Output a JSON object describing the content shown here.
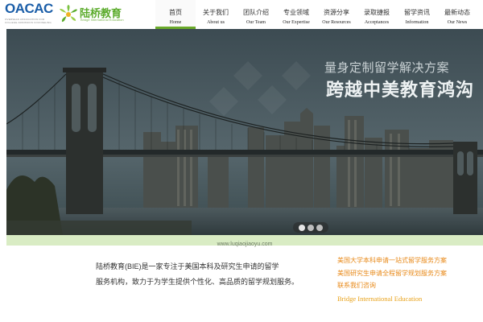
{
  "brand": {
    "oacac_logo": "OACAC",
    "oacac_subtitle": "OVERSEAS ASSOCIATION FOR COLLEGE ADMISSION COUNSELING",
    "luqiao_name": "陆桥教育",
    "luqiao_subtitle": "Bridge International Education"
  },
  "nav": [
    {
      "cn": "首页",
      "en": "Home",
      "active": true
    },
    {
      "cn": "关于我们",
      "en": "About us"
    },
    {
      "cn": "团队介绍",
      "en": "Our Team"
    },
    {
      "cn": "专业领域",
      "en": "Our Expertise"
    },
    {
      "cn": "资源分享",
      "en": "Our Resources"
    },
    {
      "cn": "录取捷报",
      "en": "Acceptances"
    },
    {
      "cn": "留学资讯",
      "en": "Information"
    },
    {
      "cn": "最新动态",
      "en": "Our News"
    }
  ],
  "hero": {
    "subtitle": "量身定制留学解决方案",
    "title": "跨越中美教育鸿沟",
    "slides": 3,
    "active_slide": 1
  },
  "url_bar": "www.luqiaojiaoyu.com",
  "intro": {
    "line1": "陆桥教育(BIE)是一家专注于美国本科及研究生申请的留学",
    "line2": "服务机构，致力于为学生提供个性化、高品质的留学规划服务。"
  },
  "links": [
    "美国大学本科申请一站式留学服务方案",
    "美国研究生申请全程留学规划服务方案",
    "联系我们咨询"
  ],
  "company_en": "Bridge International Education",
  "colors": {
    "accent_green": "#6aaa2a",
    "orange": "#e88a1a",
    "url_bar_bg": "#d9ecc4"
  }
}
